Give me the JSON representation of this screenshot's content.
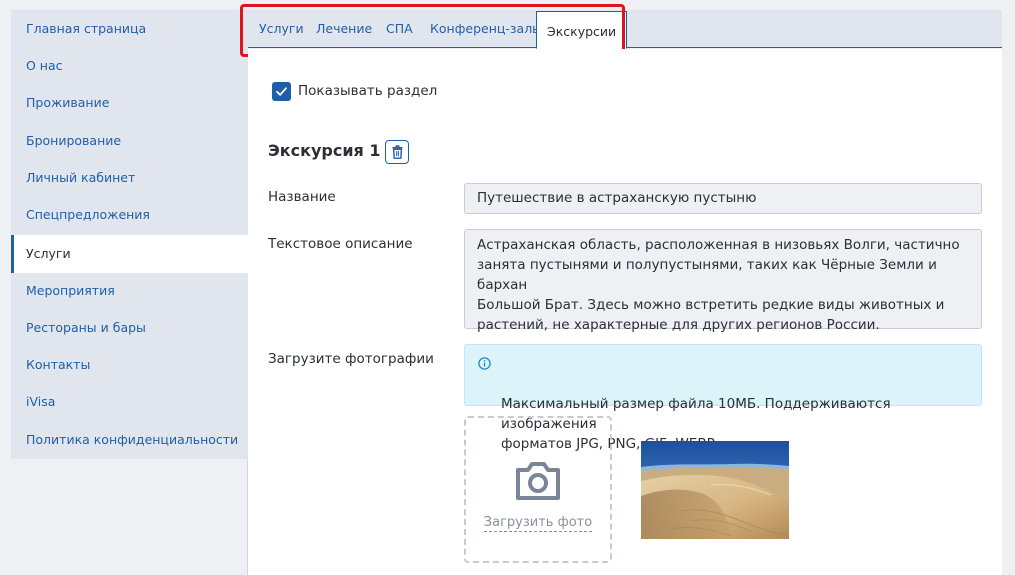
{
  "sidebar": {
    "items": [
      {
        "label": "Главная страница"
      },
      {
        "label": "О нас"
      },
      {
        "label": "Проживание"
      },
      {
        "label": "Бронирование"
      },
      {
        "label": "Личный кабинет"
      },
      {
        "label": "Спецпредложения"
      },
      {
        "label": "Услуги",
        "active": true
      },
      {
        "label": "Мероприятия"
      },
      {
        "label": "Рестораны и бары"
      },
      {
        "label": "Контакты"
      },
      {
        "label": "iVisa"
      },
      {
        "label": "Политика конфиденциальности"
      }
    ]
  },
  "tabs": [
    {
      "label": "Услуги"
    },
    {
      "label": "Лечение"
    },
    {
      "label": "СПА"
    },
    {
      "label": "Конференц-залы"
    },
    {
      "label": "Экскурсии",
      "active": true
    }
  ],
  "form": {
    "show_section": {
      "label": "Показывать раздел",
      "checked": true
    },
    "excursion_title": "Экскурсия 1",
    "name_label": "Название",
    "name_value": "Путешествие в астраханскую пустыню",
    "description_label": "Текстовое описание",
    "description_value": "Астраханская область, расположенная в низовьях Волги, частично\nзанята пустынями и полупустынями, таких как Чёрные Земли и бархан\nБольшой Брат. Здесь можно встретить редкие виды животных и\nрастений, не характерные для других регионов России.",
    "photos_label": "Загрузите фотографии",
    "info_text": "Максимальный размер файла 10МБ. Поддерживаются изображения\nформатов JPG, PNG, GIF, WEBP.",
    "upload_label": "Загрузить фото"
  },
  "icons": {
    "checkbox": "check-icon",
    "delete": "trash-icon",
    "info": "info-icon",
    "upload": "camera-icon"
  },
  "colors": {
    "accent": "#1f5fa9",
    "highlight": "#e0141e",
    "info_bg": "#dcf3fa"
  }
}
